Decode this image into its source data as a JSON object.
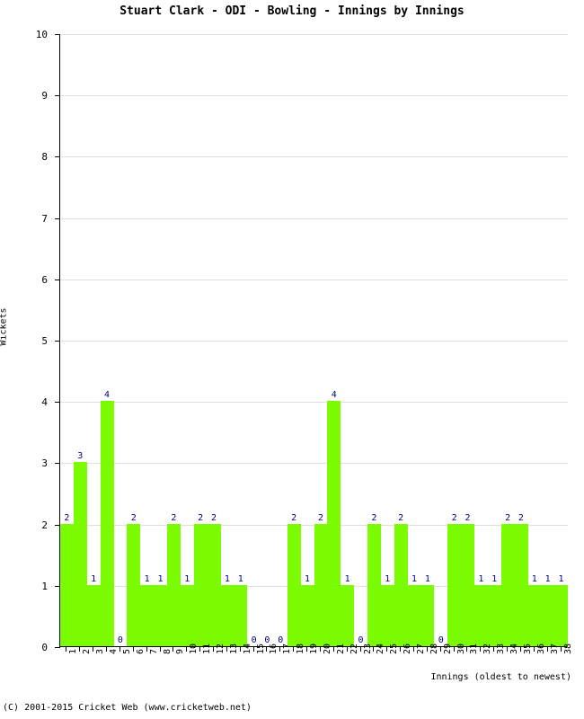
{
  "chart_data": {
    "type": "bar",
    "title": "Stuart Clark - ODI - Bowling - Innings by Innings",
    "xlabel": "Innings (oldest to newest)",
    "ylabel": "Wickets",
    "ylim": [
      0,
      10
    ],
    "ytick_labels": [
      "0",
      "1",
      "2",
      "3",
      "4",
      "5",
      "6",
      "7",
      "8",
      "9",
      "10"
    ],
    "grid": true,
    "legend": null,
    "bar_color": "#7CFC00",
    "value_label_color": "#000080",
    "categories": [
      "1",
      "2",
      "3",
      "4",
      "5",
      "6",
      "7",
      "8",
      "9",
      "10",
      "11",
      "12",
      "13",
      "14",
      "15",
      "16",
      "17",
      "18",
      "19",
      "20",
      "21",
      "22",
      "23",
      "24",
      "25",
      "26",
      "27",
      "28",
      "29",
      "30",
      "31",
      "32",
      "33",
      "34",
      "35",
      "36",
      "37",
      "38"
    ],
    "values": [
      2,
      3,
      1,
      4,
      0,
      2,
      1,
      1,
      2,
      1,
      2,
      2,
      1,
      1,
      0,
      0,
      0,
      2,
      1,
      2,
      4,
      1,
      0,
      2,
      1,
      2,
      1,
      1,
      0,
      2,
      2,
      1,
      1,
      2,
      2,
      1,
      1,
      1
    ]
  },
  "footer": {
    "copyright": "(C) 2001-2015 Cricket Web (www.cricketweb.net)"
  }
}
